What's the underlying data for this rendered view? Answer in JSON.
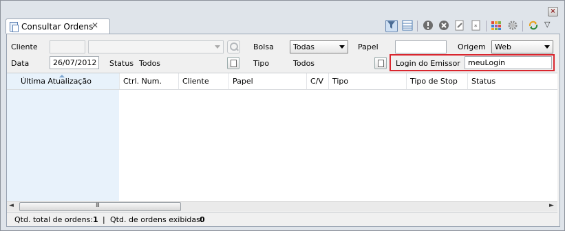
{
  "window": {
    "close_glyph": "×"
  },
  "tab": {
    "title": "Consultar Ordens",
    "close_glyph": "✕"
  },
  "toolbar": {
    "icons": [
      "filter-icon",
      "grid-icon",
      "exclamation-icon",
      "stop-icon",
      "document-icon",
      "document-star-icon",
      "color-grid-icon",
      "gear-icon",
      "refresh-icon",
      "view-menu-icon"
    ],
    "menu_glyph": "▽"
  },
  "filters": {
    "cliente_label": "Cliente",
    "cliente_code": "",
    "cliente_name": "",
    "bolsa_label": "Bolsa",
    "bolsa_value": "Todas",
    "papel_label": "Papel",
    "papel_value": "",
    "origem_label": "Origem",
    "origem_value": "Web",
    "data_label": "Data",
    "data_value": "26/07/2012",
    "status_label": "Status",
    "status_value": "Todos",
    "tipo_label": "Tipo",
    "tipo_value": "Todos",
    "login_label": "Login do Emissor",
    "login_value": "meuLogin"
  },
  "table": {
    "columns": [
      "Última Atualização",
      "Ctrl. Num.",
      "Cliente",
      "Papel",
      "C/V",
      "Tipo",
      "Tipo de Stop",
      "Status"
    ],
    "sorted_column": "Última Atualização",
    "rows": []
  },
  "scrollbar": {
    "left_arrow": "◄",
    "right_arrow": "►",
    "grip": "III"
  },
  "status": {
    "total_label": "Qtd. total de ordens:",
    "total_value": "1",
    "separator": "|",
    "shown_label": "Qtd. de ordens exibidas:",
    "shown_value": "0"
  },
  "colors": {
    "highlight": "#d9262e",
    "sorted_header": "#e8f2fb"
  }
}
